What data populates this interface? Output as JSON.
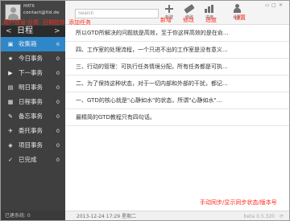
{
  "profile": {
    "name": "MRTR",
    "email": "contact@ltd.de"
  },
  "annotations": {
    "user_info": "用户信息",
    "categories": "分类",
    "date_picker": "日期控件",
    "add_task": "添加任务",
    "new": "新增",
    "edit": "修改",
    "progress": "进度",
    "settings": "设置",
    "sync_info": "手动同步/显示同步状态/版本号"
  },
  "datebar": {
    "prev": "<",
    "title": "日程",
    "next": ">"
  },
  "nav": {
    "items": [
      {
        "icon": "▣",
        "label": "收集箱",
        "count": "6",
        "icon_name": "inbox-icon"
      },
      {
        "icon": "★",
        "label": "今日事务",
        "count": "0",
        "icon_name": "star-icon"
      },
      {
        "icon": "▶",
        "label": "下一事务",
        "count": "0",
        "icon_name": "play-icon"
      },
      {
        "icon": "▤",
        "label": "明日事务",
        "count": "0",
        "icon_name": "calendar-icon"
      },
      {
        "icon": "▦",
        "label": "日程事务",
        "count": "0",
        "icon_name": "schedule-icon"
      },
      {
        "icon": "✎",
        "label": "备忘事务",
        "count": "0",
        "icon_name": "memo-icon"
      },
      {
        "icon": "✈",
        "label": "委托事务",
        "count": "0",
        "icon_name": "delegate-icon"
      },
      {
        "icon": "◈",
        "label": "项目事务",
        "count": "0",
        "icon_name": "project-icon"
      },
      {
        "icon": "✓",
        "label": "已完成",
        "count": "0",
        "icon_name": "check-icon"
      }
    ]
  },
  "statusleft": "已建系统: 0",
  "toolbar": {
    "search_placeholder": "Search",
    "new_label": "新建",
    "edit_label": "修改",
    "progress_label": "进度",
    "settings_label": "设置"
  },
  "tasks": [
    "所以GTD所解决的问题就是高效，至于你这样高效的是在俞...",
    "四、工作室的处理流程，一个只进不出的工作室是没有意义...",
    "三、行动的管理：可执行任务情境分配，所有任务都是可执...",
    "二、为了保持这种状态，对于一切内部和外部的干扰，都记...",
    "一、GTD的核心就是\"心静如水\"的状态，所谓\"心静如水\"...",
    "最精简的GTD教程只有四句话。"
  ],
  "bottombar": {
    "date": "2013-12-24  17:29  星期二",
    "version": "beta 0.5.320",
    "sync": "⟳"
  },
  "colors": {
    "accent": "#2e87c9",
    "sidebar": "#3f3f3f",
    "annotation": "#ff2a1a"
  }
}
